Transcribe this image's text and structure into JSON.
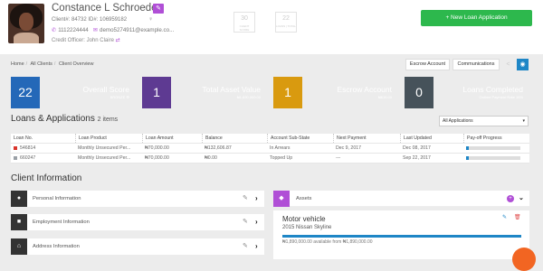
{
  "header": {
    "name": "Constance L Schroeder",
    "client_ids": "Client#: 84732   ID#: 106959182",
    "gender_symbol": "♀",
    "phone": "1112224444",
    "email": "demo5274911@example.co...",
    "officer": "Credit Officer: John Claire",
    "stats": [
      {
        "value": "30",
        "label": "CLIENT SCORE"
      },
      {
        "value": "22",
        "label": "LOANS | TOTAL"
      }
    ],
    "new_loan_label": "+ New Loan Application"
  },
  "breadcrumb": [
    "Home",
    "All Clients",
    "Client Overview"
  ],
  "toolbar": {
    "escrow": "Escrow Account",
    "communications": "Communications"
  },
  "cards": [
    {
      "value": "22",
      "title": "Overall Score",
      "sub": "BRONZE ⚙",
      "color": "#2c7bd6"
    },
    {
      "value": "1",
      "title": "Total Asset Value",
      "sub": "₦1,890,000.00",
      "color": "#7c4fb3"
    },
    {
      "value": "1",
      "title": "Escrow Account",
      "sub": "₦616.00",
      "color": "#f4b51f"
    },
    {
      "value": "0",
      "title": "Loans Completed",
      "sub": "Ontime Payment Rate 16%",
      "color": "#5b6770"
    }
  ],
  "loans": {
    "title": "Loans & Applications",
    "count": "2 items",
    "filter": "All Applications",
    "columns": [
      "Loan No.",
      "Loan Product",
      "Loan Amount",
      "Balance",
      "Account Sub-State",
      "Next Payment",
      "Last Updated",
      "Pay-off Progress"
    ],
    "rows": [
      {
        "status_color": "#d9342b",
        "no": "546814",
        "product": "Monthly Unsecured Per...",
        "amount": "₦70,000.00",
        "balance": "₦132,606.87",
        "substate": "In Arrears",
        "next": "Dec 9, 2017",
        "updated": "Dec 08, 2017",
        "progress": 0.05
      },
      {
        "status_color": "#9aa0a6",
        "no": "660247",
        "product": "Monthly Unsecured Per...",
        "amount": "₦70,000.00",
        "balance": "₦0.00",
        "substate": "Topped Up",
        "next": "---",
        "updated": "Sep 22, 2017",
        "progress": 0.05
      }
    ]
  },
  "client_info": {
    "title": "Client Information",
    "rows": [
      {
        "label": "Personal Information",
        "icon": "user-icon"
      },
      {
        "label": "Employment Information",
        "icon": "briefcase-icon"
      },
      {
        "label": "Address Information",
        "icon": "home-icon"
      }
    ]
  },
  "assets": {
    "label": "Assets",
    "item_title": "Motor vehicle",
    "item_sub": "2015 Nissan Skyline",
    "item_avail": "₦1,890,000.00 available from ₦1,890,000.00",
    "progress": 1.0
  }
}
